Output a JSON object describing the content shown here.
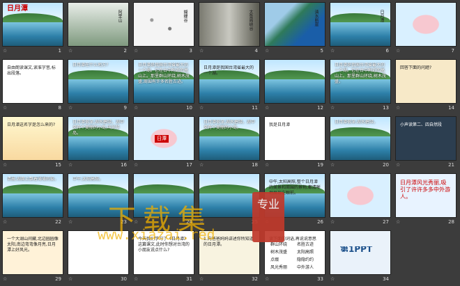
{
  "slides": [
    {
      "n": "1",
      "title": "日月潭",
      "bg": "#cfe8f7",
      "style": "title"
    },
    {
      "n": "2",
      "title": "阿里山",
      "bg": "#eef3ee",
      "style": "mist"
    },
    {
      "n": "3",
      "title": "蝴蝶谷",
      "bg": "#f4f4f4",
      "style": "flowers"
    },
    {
      "n": "4",
      "title": "太鲁阁峡谷",
      "bg": "#d8d8d8",
      "style": "canyon"
    },
    {
      "n": "5",
      "title": "清水断崖",
      "bg": "#9fcbe8",
      "style": "coast"
    },
    {
      "n": "6",
      "title": "日月潭",
      "bg": "#bfe6ff",
      "style": "lake"
    },
    {
      "n": "7",
      "title": "",
      "bg": "#fdfdf0",
      "style": "map"
    },
    {
      "n": "8",
      "title": "自由朗读课文,读准字音,标出段落。",
      "bg": "#ffffff",
      "style": "text"
    },
    {
      "n": "9",
      "title": "日月潭在什么地方?",
      "bg": "#bfe6ff",
      "style": "lake"
    },
    {
      "n": "10",
      "title": "日月潭是我国台湾省最大的一个湖。它在台中附近的高山上。那里群山环绕,树木茂盛,周围有许多名胜古迹。",
      "bg": "#bfe6ff",
      "style": "lake"
    },
    {
      "n": "11",
      "title": "日月潭是我国台湾省最大的一个湖。",
      "bg": "#ffffff",
      "style": "textlake"
    },
    {
      "n": "12",
      "title": "",
      "bg": "#bfe6ff",
      "style": "lake"
    },
    {
      "n": "13",
      "title": "日月潭是我国台湾省最大的一个湖。它在台中附近的高山上。那里群山环绕,树木茂盛。",
      "bg": "#bfe6ff",
      "style": "lake"
    },
    {
      "n": "14",
      "title": "回答下面的问题?",
      "bg": "#f7e9c8",
      "style": "note"
    },
    {
      "n": "15",
      "title": "日月潭这名字是怎么来的?",
      "bg": "#fff8d0",
      "style": "cartoon"
    },
    {
      "n": "16",
      "title": "日月潭很深,湖水碧绿。湖中央有个美丽的小岛,叫光华岛。",
      "bg": "#bfe6ff",
      "style": "lake"
    },
    {
      "n": "17",
      "title": "日潭",
      "bg": "#d9f0ff",
      "style": "mapisland"
    },
    {
      "n": "18",
      "title": "日月潭很深,湖水碧绿。湖中央有个美丽的小岛。",
      "bg": "#bfe6ff",
      "style": "lake"
    },
    {
      "n": "19",
      "title": "我是日月潭",
      "bg": "#ffffff",
      "style": "text"
    },
    {
      "n": "20",
      "title": "日月潭很深,湖水碧绿。",
      "bg": "#bfe6ff",
      "style": "lake"
    },
    {
      "n": "21",
      "title": "小声读第二、四自然段",
      "bg": "#2c3e50",
      "style": "dark"
    },
    {
      "n": "22",
      "title": "清晨,湖面上飘着薄薄的雾。",
      "bg": "#9fc6e0",
      "style": "lake2"
    },
    {
      "n": "23",
      "title": "中午,太阳高照。",
      "bg": "#bfe6ff",
      "style": "lake"
    },
    {
      "n": "24",
      "title": "",
      "bg": "#bfe6ff",
      "style": "lake"
    },
    {
      "n": "25",
      "title": "",
      "bg": "#bfe6ff",
      "style": "lake"
    },
    {
      "n": "26",
      "title": "中午,太阳高照,整个日月潭的美景和周围的景物,都清晰地展现在眼前。",
      "bg": "#fffbe8",
      "style": "textlake"
    },
    {
      "n": "27",
      "title": "",
      "bg": "#cfe8f7",
      "style": "map"
    },
    {
      "n": "28",
      "title": "日月潭风光秀丽,吸引了许许多多中外游人。",
      "bg": "#e8f3ff",
      "style": "text"
    },
    {
      "n": "29",
      "title": "一个大湖山间藏,北边圆圆像太阳,南边弯弯像月亮,日月潭上好风光。",
      "bg": "#fff2d8",
      "style": "text"
    },
    {
      "n": "30",
      "title": "",
      "bg": "#ffffff",
      "style": "text"
    },
    {
      "n": "31",
      "title": "今天我们学习了《日月潭》这篇课文,此时你想对台湾的小朋友说点什么?",
      "bg": "#ffffff",
      "style": "text"
    },
    {
      "n": "32",
      "title": "1.向爸爸妈妈讲述你所知道的日月潭。",
      "bg": "#f8f3e0",
      "style": "note"
    },
    {
      "n": "33",
      "title": "读下面的词语,再说说意思",
      "bg": "#ffffff",
      "style": "words"
    },
    {
      "n": "34",
      "title": "第1PPT",
      "bg": "#eaf2fa",
      "style": "logo"
    }
  ],
  "watermark": {
    "cn": "下载集",
    "url": "www.xiazai.red",
    "badge": "专业"
  },
  "slide33_words": [
    "群山环绕",
    "名胜古迹",
    "树木茂盛",
    "太阳高照",
    "点缀",
    "隐隐约约",
    "风光秀丽",
    "中外游人"
  ]
}
